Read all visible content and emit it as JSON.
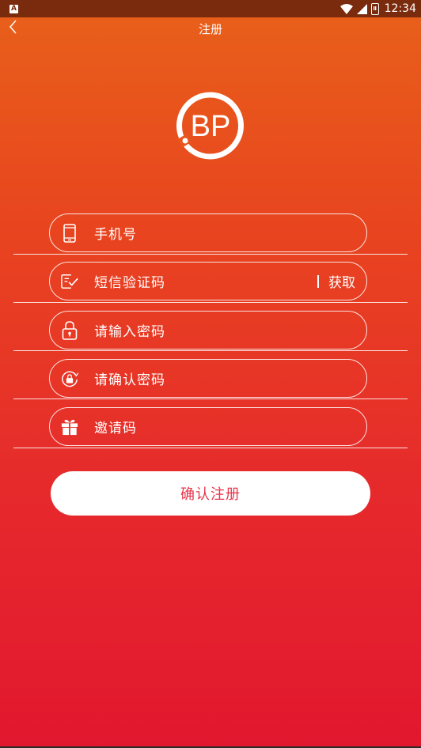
{
  "status_bar": {
    "notification_icon_letter": "A",
    "time": "12:34",
    "battery_level_char": "Ⅱ"
  },
  "header": {
    "title": "注册"
  },
  "logo": {
    "text": "BP"
  },
  "form": {
    "phone_placeholder": "手机号",
    "sms_code_placeholder": "短信验证码",
    "get_code_label": "获取",
    "password_placeholder": "请输入密码",
    "confirm_password_placeholder": "请确认密码",
    "invite_code_placeholder": "邀请码"
  },
  "actions": {
    "submit_label": "确认注册"
  },
  "colors": {
    "gradient_top": "#e8611a",
    "gradient_bottom": "#e2172f",
    "submit_text": "#e8334a"
  }
}
